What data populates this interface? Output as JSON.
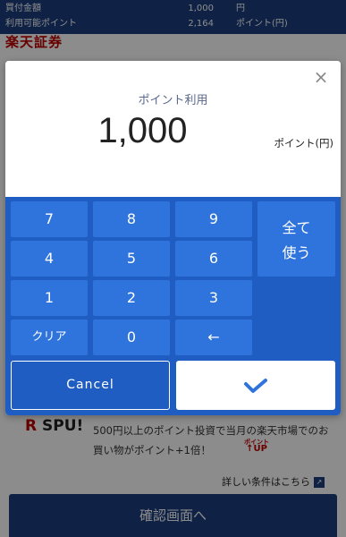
{
  "summary": {
    "row1": {
      "label": "買付金額",
      "value": "1,000",
      "unit": "円"
    },
    "row2": {
      "label": "利用可能ポイント",
      "value": "2,164",
      "unit": "ポイント(円)"
    }
  },
  "brand": "楽天証券",
  "modal": {
    "close": "×",
    "title": "ポイント利用",
    "amount": "1,000",
    "amount_unit": "ポイント(円)"
  },
  "keypad": {
    "k7": "7",
    "k8": "8",
    "k9": "9",
    "k4": "4",
    "k5": "5",
    "k6": "6",
    "k1": "1",
    "k2": "2",
    "k3": "3",
    "clear": "クリア",
    "k0": "0",
    "backspace": "←",
    "use_all_line1": "全て",
    "use_all_line2": "使う"
  },
  "actions": {
    "cancel": "Cancel",
    "ok_icon": "check-icon"
  },
  "spu": {
    "logo_r": "R",
    "logo_text": "SPU!",
    "text": "500円以上のポイント投資で当月の楽天市場でのお買い物がポイント+1倍！",
    "badge_small": "ポイント",
    "badge_big": "↑UP",
    "detail_link": "詳しい条件はこちら"
  },
  "confirm_button": "確認画面へ",
  "colors": {
    "navy": "#1d3f7f",
    "pad_blue": "#1f5dc3",
    "key_blue": "#2f74dc",
    "brand_red": "#bf0000"
  }
}
